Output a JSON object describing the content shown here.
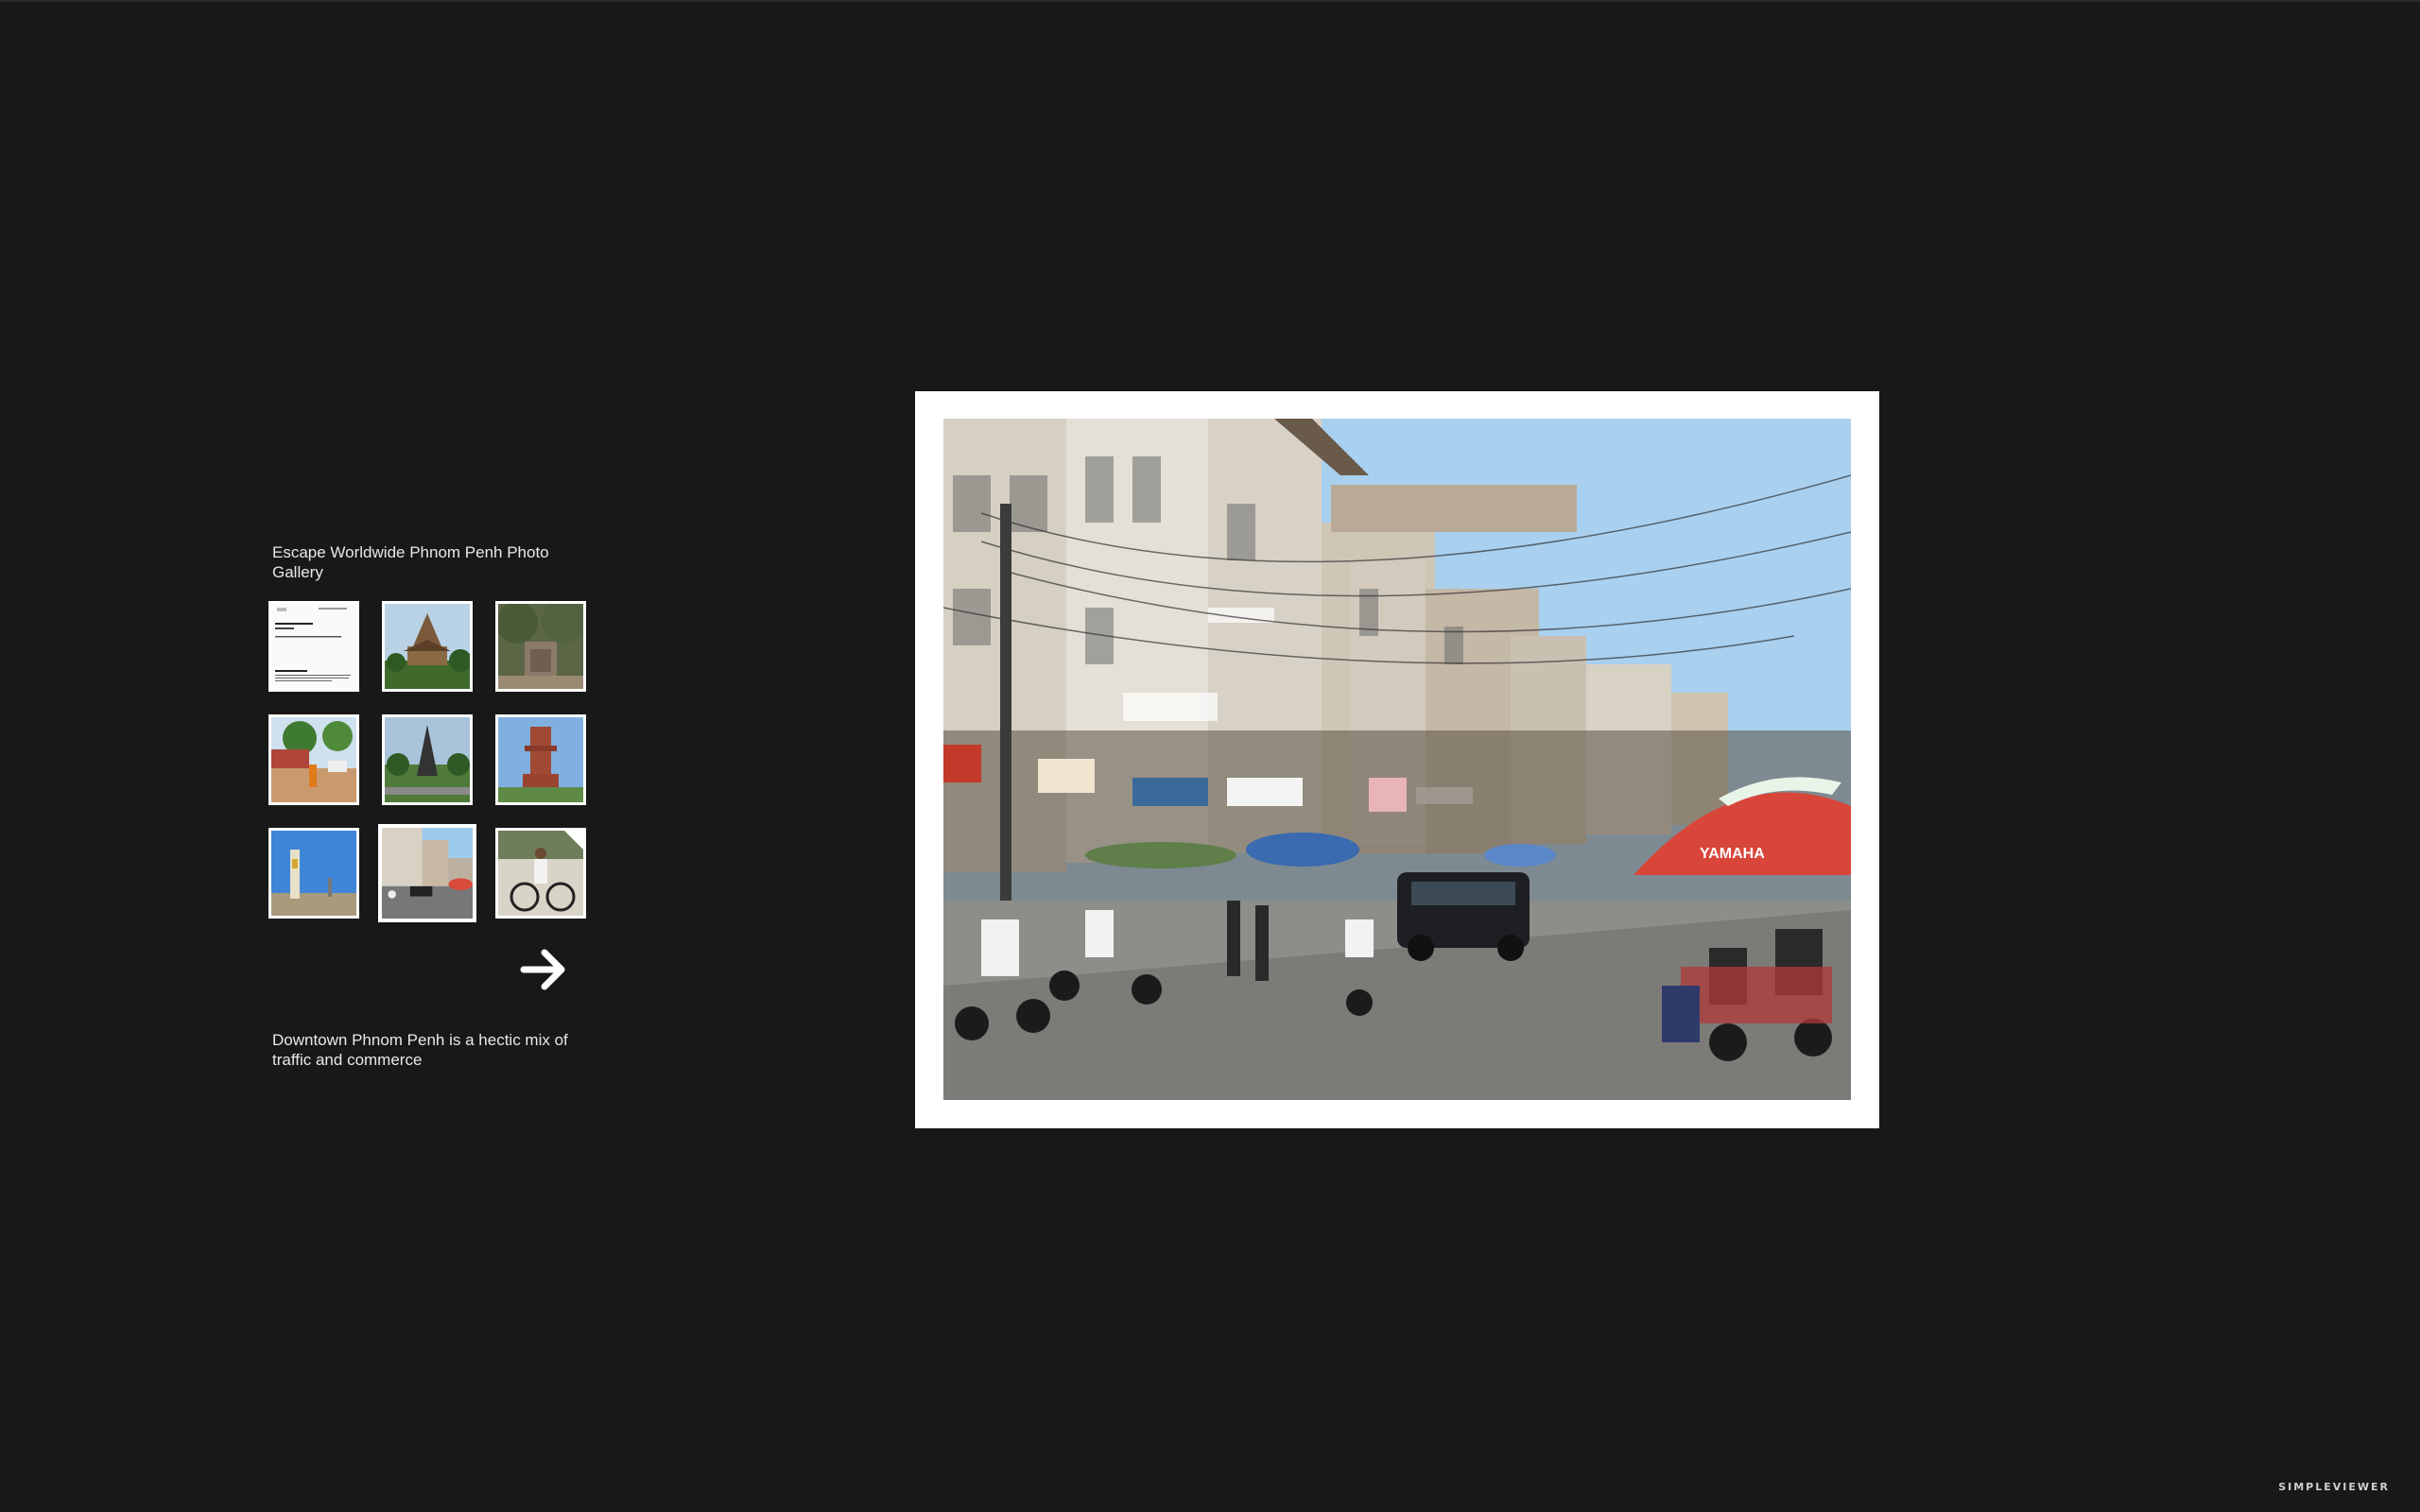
{
  "gallery": {
    "title": "Escape Worldwide Phnom Penh Photo Gallery",
    "caption": "Downtown Phnom Penh is a hectic mix of traffic and commerce",
    "thumbnails": [
      {
        "subject": "document page"
      },
      {
        "subject": "pagoda temple"
      },
      {
        "subject": "stone ruins"
      },
      {
        "subject": "monk street"
      },
      {
        "subject": "monument park"
      },
      {
        "subject": "red stupa"
      },
      {
        "subject": "tower monument"
      },
      {
        "subject": "street traffic",
        "selected": true
      },
      {
        "subject": "cyclo rider"
      }
    ],
    "selected_index": 7,
    "next_icon": "arrow-right-icon"
  },
  "main_photo": {
    "subject": "downtown street scene",
    "umbrella_text": "YAMAHA"
  },
  "branding": {
    "label": "SIMPLEVIEWER"
  },
  "colors": {
    "background": "#181818",
    "frame": "#ffffff",
    "text": "#e8e8e8"
  }
}
